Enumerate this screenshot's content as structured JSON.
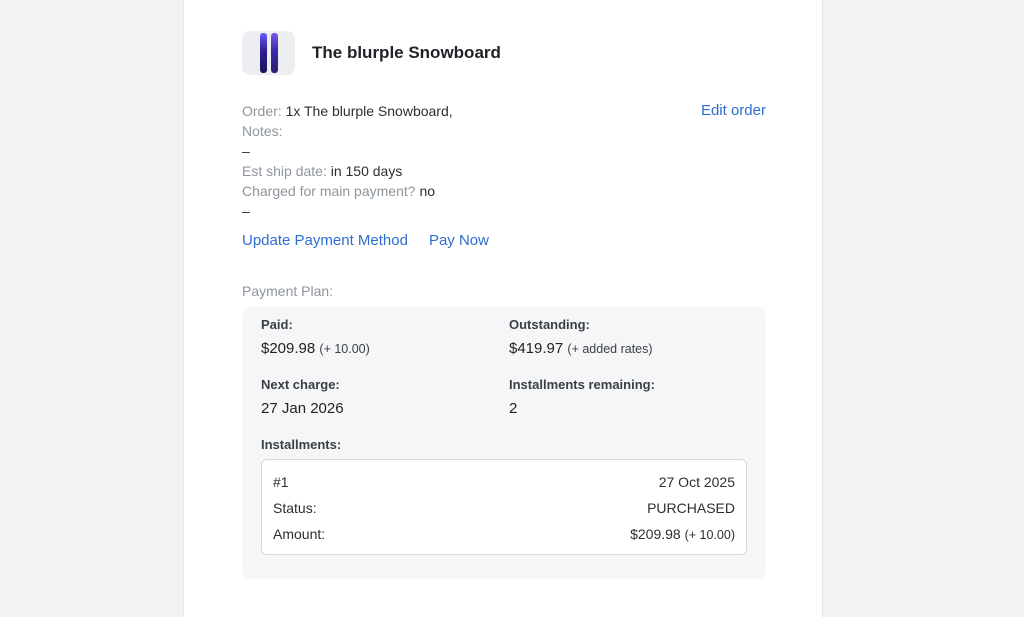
{
  "product": {
    "title": "The blurple Snowboard",
    "thumbnail_icon": "snowboard-icon"
  },
  "order": {
    "order_label": "Order:",
    "order_value": "1x The blurple Snowboard,",
    "notes_label": "Notes:",
    "notes_value": "–",
    "ship_label": "Est ship date:",
    "ship_value": "in 150 days",
    "charged_label": "Charged for main payment?",
    "charged_value": "no",
    "extra_value": "–",
    "edit_link": "Edit order"
  },
  "actions": {
    "update_payment": "Update Payment Method",
    "pay_now": "Pay Now"
  },
  "plan": {
    "label": "Payment Plan:",
    "paid_label": "Paid:",
    "paid_value": "$209.98",
    "paid_extra": "(+ 10.00)",
    "outstanding_label": "Outstanding:",
    "outstanding_value": "$419.97",
    "outstanding_extra": "(+ added rates)",
    "next_charge_label": "Next charge:",
    "next_charge_value": "27 Jan 2026",
    "remaining_label": "Installments remaining:",
    "remaining_value": "2",
    "installments_label": "Installments:",
    "installments": [
      {
        "number": "#1",
        "date": "27 Oct 2025",
        "status_label": "Status:",
        "status_value": "PURCHASED",
        "amount_label": "Amount:",
        "amount_value": "$209.98",
        "amount_extra": "(+ 10.00)"
      }
    ]
  },
  "colors": {
    "link": "#2e6ecf",
    "muted_label": "#8e959d",
    "page_bg": "#f1f2f4",
    "plan_bg": "#f5f6f7"
  }
}
